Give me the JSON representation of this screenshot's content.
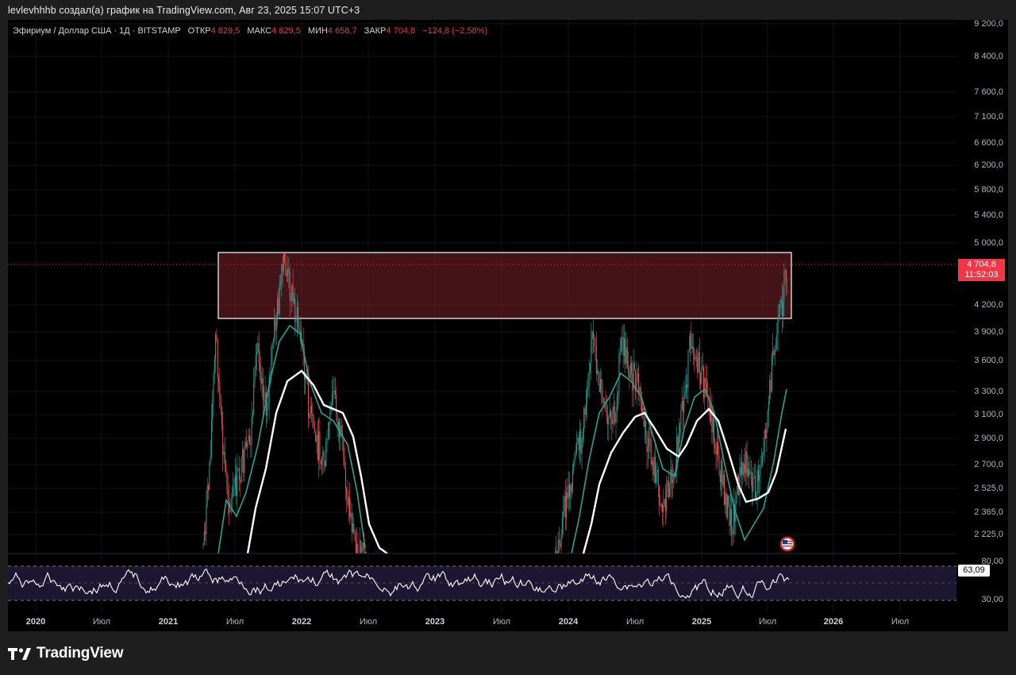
{
  "header": {
    "caption": "levlevhhhb создал(а) график на TradingView.com, Авг 23, 2025 15:07 UTC+3"
  },
  "legend": {
    "symbol": "Эфириум / Доллар США · 1Д · BITSTAMP",
    "open_label": "ОТКР",
    "open": "4 829,5",
    "high_label": "МАКС",
    "high": "4 829,5",
    "low_label": "МИН",
    "low": "4 658,7",
    "close_label": "ЗАКР",
    "close": "4 704,8",
    "change": "−124,8 (−2,58%)"
  },
  "price_axis": [
    "9 200,0",
    "8 400,0",
    "7 600,0",
    "7 100,0",
    "6 600,0",
    "6 200,0",
    "5 800,0",
    "5 400,0",
    "5 000,0",
    "4 200,0",
    "3 900,0",
    "3 600,0",
    "3 300,0",
    "3 100,0",
    "2 900,0",
    "2 700,0",
    "2 525,0",
    "2 365,0",
    "2 225,0"
  ],
  "current_price": {
    "value": "4 704,8",
    "countdown": "11:52:03"
  },
  "rsi_axis": {
    "upper": "80,00",
    "lower": "30,00",
    "value": "63,09"
  },
  "time_axis": [
    {
      "label": "2020",
      "year": true
    },
    {
      "label": "Июл",
      "year": false
    },
    {
      "label": "2021",
      "year": true
    },
    {
      "label": "Июл",
      "year": false
    },
    {
      "label": "2022",
      "year": true
    },
    {
      "label": "Июл",
      "year": false
    },
    {
      "label": "2023",
      "year": true
    },
    {
      "label": "Июл",
      "year": false
    },
    {
      "label": "2024",
      "year": true
    },
    {
      "label": "Июл",
      "year": false
    },
    {
      "label": "2025",
      "year": true
    },
    {
      "label": "Июл",
      "year": false
    },
    {
      "label": "2026",
      "year": true
    },
    {
      "label": "Июл",
      "year": false
    }
  ],
  "footer": {
    "brand": "TradingView"
  },
  "colors": {
    "background": "#000000",
    "up": "#26a69a",
    "down": "#ef5350",
    "ma_slow": "#ffffff",
    "ma_fast": "#26a69a",
    "zone_fill": "#5a1a20",
    "price_tag": "#f23645"
  },
  "chart_data": {
    "type": "candlestick",
    "scale": "log",
    "symbol": "ETH/USD",
    "interval": "1D",
    "last": {
      "open": 4829.5,
      "high": 4829.5,
      "low": 4658.7,
      "close": 4704.8
    },
    "resistance_zone": {
      "low": 4050,
      "high": 4870
    },
    "indicators": [
      "RSI",
      "MA",
      "MA"
    ]
  }
}
